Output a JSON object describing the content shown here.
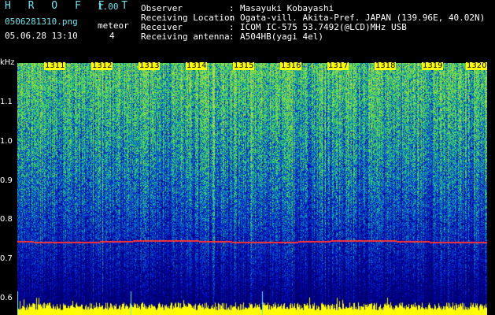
{
  "app": {
    "title": "H R O F F T",
    "version": "1.00"
  },
  "file": {
    "name": "0506281310.png",
    "datetime": "05.06.28 13:10"
  },
  "meteor": {
    "label": "meteor",
    "count": "4"
  },
  "info": [
    {
      "key": "Observer",
      "value": "Masayuki Kobayashi"
    },
    {
      "key": "Receiving Location",
      "value": "Ogata-vill. Akita-Pref. JAPAN (139.96E, 40.02N)"
    },
    {
      "key": "Receiver",
      "value": "ICOM IC-575 53.7492(@LCD)MHz USB"
    },
    {
      "key": "Receiving antenna",
      "value": "A504HB(yagi 4el)"
    }
  ],
  "axis": {
    "y_unit": "kHz",
    "y_ticks": [
      "1.1",
      "1.0",
      "0.9",
      "0.8",
      "0.7",
      "0.6"
    ],
    "time_ticks": [
      "1311",
      "1312",
      "1313",
      "1314",
      "1315",
      "1316",
      "1317",
      "1318",
      "1319",
      "1320"
    ]
  },
  "colors": {
    "cyan": "#6fe3e8",
    "trace": "#ff3333",
    "baseline": "#ffff00"
  }
}
